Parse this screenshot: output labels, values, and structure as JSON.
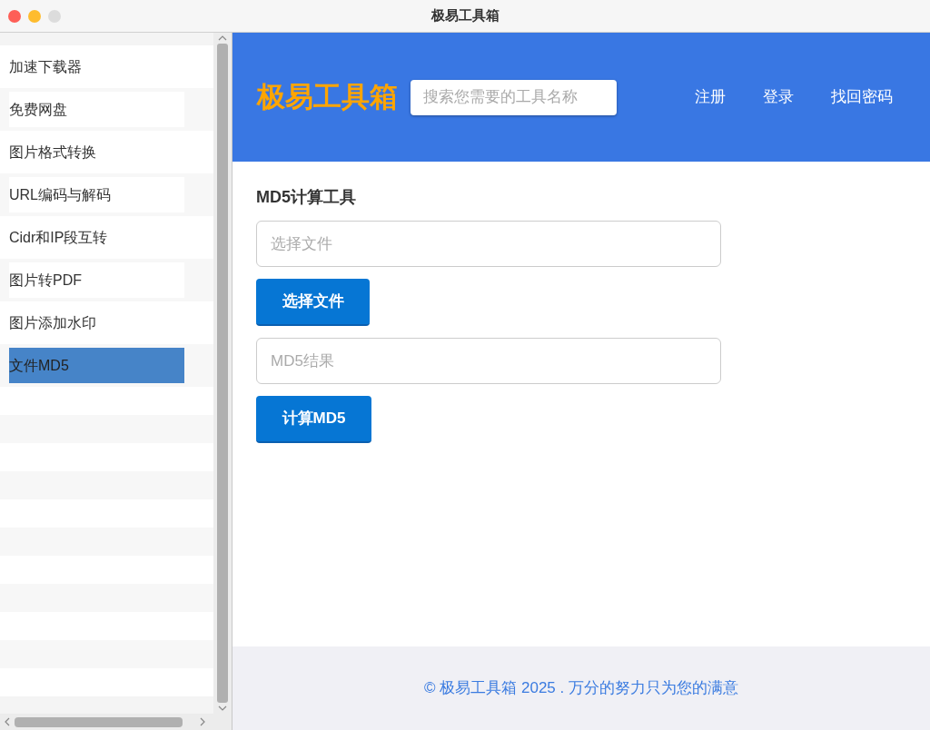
{
  "window": {
    "title": "极易工具箱"
  },
  "sidebar": {
    "items": [
      {
        "label": "加速下载器",
        "selected": false
      },
      {
        "label": "免费网盘",
        "selected": false
      },
      {
        "label": "图片格式转换",
        "selected": false
      },
      {
        "label": "URL编码与解码",
        "selected": false
      },
      {
        "label": "Cidr和IP段互转",
        "selected": false
      },
      {
        "label": "图片转PDF",
        "selected": false
      },
      {
        "label": "图片添加水印",
        "selected": false
      },
      {
        "label": "文件MD5",
        "selected": true
      }
    ]
  },
  "header": {
    "logo": "极易工具箱",
    "search": {
      "placeholder": "搜索您需要的工具名称"
    },
    "links": [
      "注册",
      "登录",
      "找回密码"
    ]
  },
  "content": {
    "title": "MD5计算工具",
    "file_field": {
      "placeholder": "选择文件"
    },
    "choose_button": "选择文件",
    "result_field": {
      "placeholder": "MD5结果"
    },
    "compute_button": "计算MD5"
  },
  "footer": {
    "text": "© 极易工具箱 2025 . 万分的努力只为您的满意"
  }
}
